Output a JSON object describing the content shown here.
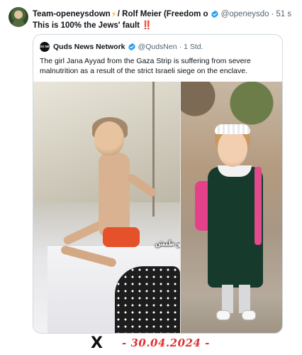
{
  "tweet": {
    "author_name": "Team-openeysdown",
    "author_emoji": "⚡",
    "author_name_suffix": "/ Rolf Meier (Freedom o",
    "handle": "@openeysdo",
    "time": "51 s",
    "text": "This is 100% the Jews' fault",
    "text_emoji": "‼️"
  },
  "quote": {
    "avatar_text": "QUDS NEWS",
    "author_name": "Quds News Network",
    "handle": "@QudsNen",
    "time": "1 Std.",
    "text": "The girl Jana Ayyad from the Gaza Strip is suffering from severe malnutrition as a result of the strict Israeli siege on the enclave.",
    "image_watermark": "تصوير عمرو طبش"
  },
  "footer": {
    "logo": "X",
    "date": "- 30.04.2024 -"
  },
  "colors": {
    "verified_badge": "#1d9bf0",
    "date_red": "#e03030",
    "muted": "#536471"
  }
}
